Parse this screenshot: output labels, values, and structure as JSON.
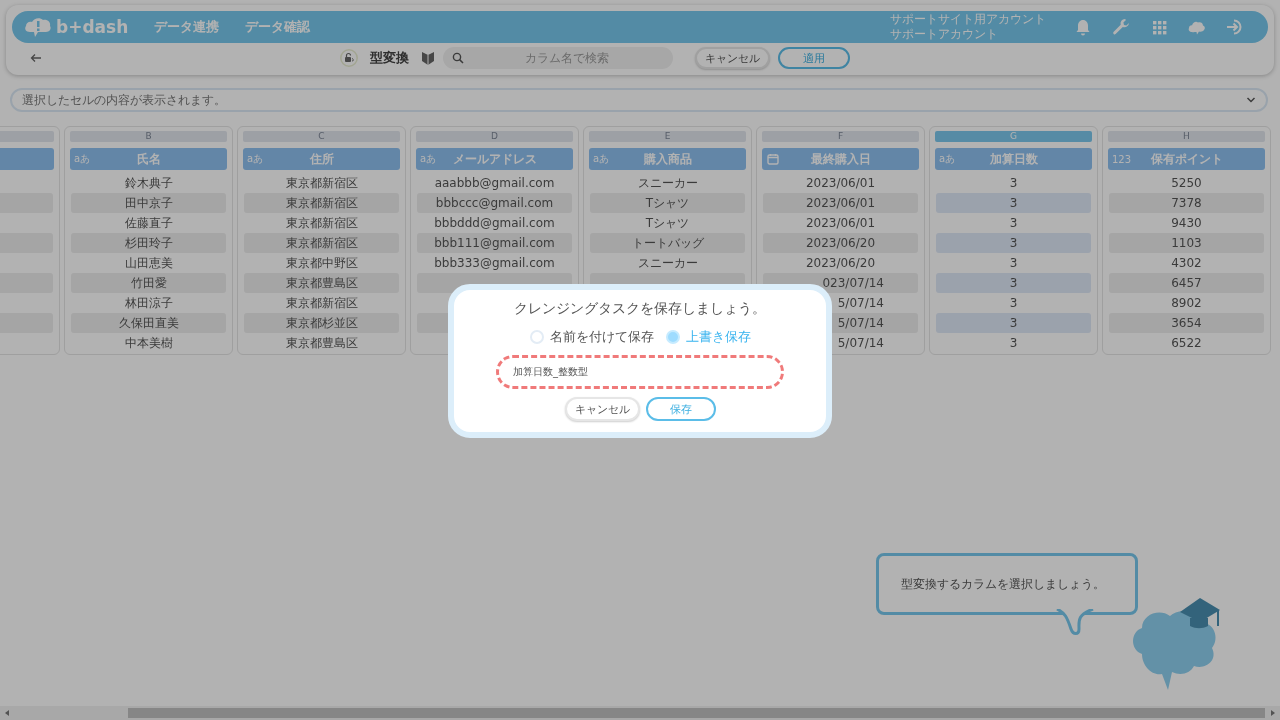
{
  "header": {
    "logo": "b+dash",
    "nav": [
      "データ連携",
      "データ確認"
    ],
    "account": [
      "サポートサイト用アカウント",
      "サポートアカウント"
    ]
  },
  "toolbar": {
    "title": "型変換",
    "search": {
      "placeholder": "カラム名で検索"
    },
    "buttons": [
      {
        "label": "キャンセル",
        "kind": "plain"
      },
      {
        "label": "適用",
        "kind": "primary"
      }
    ]
  },
  "cell_preview": {
    "placeholder": "選択したセルの内容が表示されます。"
  },
  "columns": [
    {
      "selected": false
    },
    {
      "letter": "B",
      "type_label": "aあ",
      "name": "氏名",
      "selected": false,
      "cells": [
        "鈴木典子",
        "田中京子",
        "佐藤直子",
        "杉田玲子",
        "山田恵美",
        "竹田愛",
        "林田涼子",
        "久保田直美",
        "中本美樹"
      ]
    },
    {
      "letter": "C",
      "type_label": "aあ",
      "name": "住所",
      "selected": false,
      "cells": [
        "東京都新宿区",
        "東京都新宿区",
        "東京都新宿区",
        "東京都新宿区",
        "東京都中野区",
        "東京都豊島区",
        "東京都新宿区",
        "東京都杉並区",
        "東京都豊島区"
      ]
    },
    {
      "letter": "D",
      "type_label": "aあ",
      "name": "メールアドレス",
      "selected": false,
      "cells": [
        "aaabbb@gmail.com",
        "bbbccc@gmail.com",
        "bbbddd@gmail.com",
        "bbb111@gmail.com",
        "bbb333@gmail.com",
        null,
        null,
        null,
        null
      ]
    },
    {
      "letter": "E",
      "type_label": "aあ",
      "name": "購入商品",
      "selected": false,
      "cells": [
        "スニーカー",
        "Tシャツ",
        "Tシャツ",
        "トートバッグ",
        "スニーカー",
        null,
        null
      ]
    },
    {
      "letter": "F",
      "kind": "date",
      "name": "最終購入日",
      "selected": false,
      "cells": [
        "2023/06/01",
        "2023/06/01",
        "2023/06/01",
        "2023/06/20",
        "2023/06/20",
        {
          "text": "023/07/14",
          "cut": true
        },
        {
          "text": "5/07/14",
          "cut": true
        },
        {
          "text": "5/07/14",
          "cut": true
        },
        {
          "text": "5/07/14",
          "cut": true
        }
      ]
    },
    {
      "letter": "G",
      "type_label": "aあ",
      "name": "加算日数",
      "selected": true,
      "cells": [
        "3",
        "3",
        "3",
        "3",
        "3",
        "3",
        "3",
        "3",
        "3"
      ]
    },
    {
      "letter": "H",
      "type_label": "123",
      "name": "保有ポイント",
      "selected": false,
      "cells": [
        "5250",
        "7378",
        "9430",
        "1103",
        "4302",
        "6457",
        "8902",
        "3654",
        "6522"
      ]
    }
  ],
  "dialog": {
    "title": "クレンジングタスクを保存しましょう。",
    "options": [
      {
        "label": "名前を付けて保存",
        "selected": false
      },
      {
        "label": "上書き保存",
        "selected": true
      }
    ],
    "name_field": {
      "value": "加算日数_整数型",
      "highlighted": true
    },
    "buttons": [
      {
        "label": "キャンセル",
        "kind": "plain"
      },
      {
        "label": "保存",
        "kind": "primary"
      }
    ]
  },
  "hint": {
    "text": "型変換するカラムを選択しましょう。"
  }
}
